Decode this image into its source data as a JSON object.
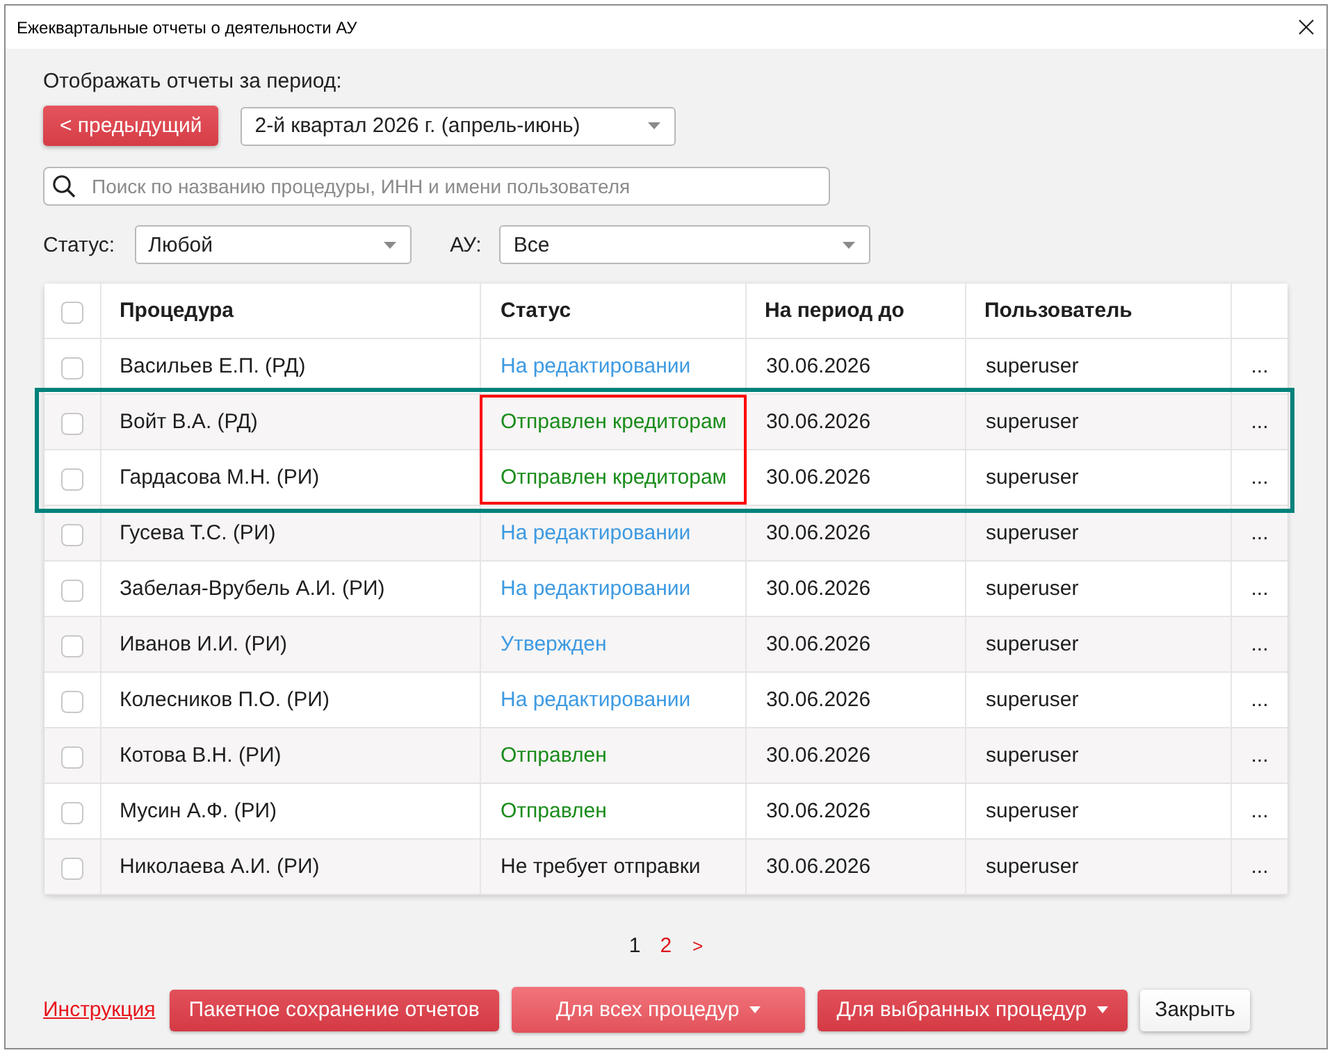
{
  "window": {
    "title": "Ежеквартальные отчеты о деятельности АУ"
  },
  "period": {
    "label": "Отображать отчеты за период:",
    "previous_button": "< предыдущий",
    "value": "2-й квартал 2026 г. (апрель-июнь)"
  },
  "search": {
    "placeholder": "Поиск по названию процедуры, ИНН и имени пользователя"
  },
  "filters": [
    {
      "label": "Статус:",
      "value": "Любой"
    },
    {
      "label": "АУ:",
      "value": "Все"
    }
  ],
  "table": {
    "select_all": {
      "checked": false
    },
    "columns": [
      "Процедура",
      "Статус",
      "На период до",
      "Пользователь"
    ],
    "rows": [
      {
        "checked": false,
        "procedure": "Васильев Е.П. (РД)",
        "status": {
          "text": "На редактировании",
          "color": "#3d9ae2"
        },
        "period_end": "30.06.2026",
        "user": "superuser",
        "actions": "...",
        "framed": false,
        "status_framed": false
      },
      {
        "checked": false,
        "procedure": "Войт В.А. (РД)",
        "status": {
          "text": "Отправлен кредиторам",
          "color": "#1a8c1a"
        },
        "period_end": "30.06.2026",
        "user": "superuser",
        "actions": "...",
        "framed": true,
        "status_framed": true
      },
      {
        "checked": false,
        "procedure": "Гардасова М.Н. (РИ)",
        "status": {
          "text": "Отправлен кредиторам",
          "color": "#1a8c1a"
        },
        "period_end": "30.06.2026",
        "user": "superuser",
        "actions": "...",
        "framed": true,
        "status_framed": true
      },
      {
        "checked": false,
        "procedure": "Гусева Т.С. (РИ)",
        "status": {
          "text": "На редактировании",
          "color": "#3d9ae2"
        },
        "period_end": "30.06.2026",
        "user": "superuser",
        "actions": "...",
        "framed": false,
        "status_framed": false
      },
      {
        "checked": false,
        "procedure": "Забелая-Врубель А.И. (РИ)",
        "status": {
          "text": "На редактировании",
          "color": "#3d9ae2"
        },
        "period_end": "30.06.2026",
        "user": "superuser",
        "actions": "...",
        "framed": false,
        "status_framed": false
      },
      {
        "checked": false,
        "procedure": "Иванов И.И. (РИ)",
        "status": {
          "text": "Утвержден",
          "color": "#3d9ae2"
        },
        "period_end": "30.06.2026",
        "user": "superuser",
        "actions": "...",
        "framed": false,
        "status_framed": false
      },
      {
        "checked": false,
        "procedure": "Колесников П.О. (РИ)",
        "status": {
          "text": "На редактировании",
          "color": "#3d9ae2"
        },
        "period_end": "30.06.2026",
        "user": "superuser",
        "actions": "...",
        "framed": false,
        "status_framed": false
      },
      {
        "checked": false,
        "procedure": "Котова В.Н. (РИ)",
        "status": {
          "text": "Отправлен",
          "color": "#1a8c1a"
        },
        "period_end": "30.06.2026",
        "user": "superuser",
        "actions": "...",
        "framed": false,
        "status_framed": false
      },
      {
        "checked": false,
        "procedure": "Мусин А.Ф. (РИ)",
        "status": {
          "text": "Отправлен",
          "color": "#1a8c1a"
        },
        "period_end": "30.06.2026",
        "user": "superuser",
        "actions": "...",
        "framed": false,
        "status_framed": false
      },
      {
        "checked": false,
        "procedure": "Николаева А.И. (РИ)",
        "status": {
          "text": "Не требует отправки",
          "color": "#1e1e1e"
        },
        "period_end": "30.06.2026",
        "user": "superuser",
        "actions": "...",
        "framed": false,
        "status_framed": false
      }
    ]
  },
  "pagination": {
    "pages": [
      {
        "label": "1",
        "selected": true
      },
      {
        "label": "2",
        "selected": false
      }
    ],
    "next": ">"
  },
  "footer": {
    "link": "Инструкция",
    "buttons": [
      {
        "label": "Пакетное сохранение отчетов",
        "kind": "filled",
        "menu": false,
        "hovered": false
      },
      {
        "label": "Для всех процедур",
        "kind": "filled",
        "menu": true,
        "hovered": true
      },
      {
        "label": "Для выбранных процедур",
        "kind": "filled",
        "menu": true,
        "hovered": false
      },
      {
        "label": "Закрыть",
        "kind": "plain",
        "menu": false,
        "hovered": false
      }
    ]
  }
}
